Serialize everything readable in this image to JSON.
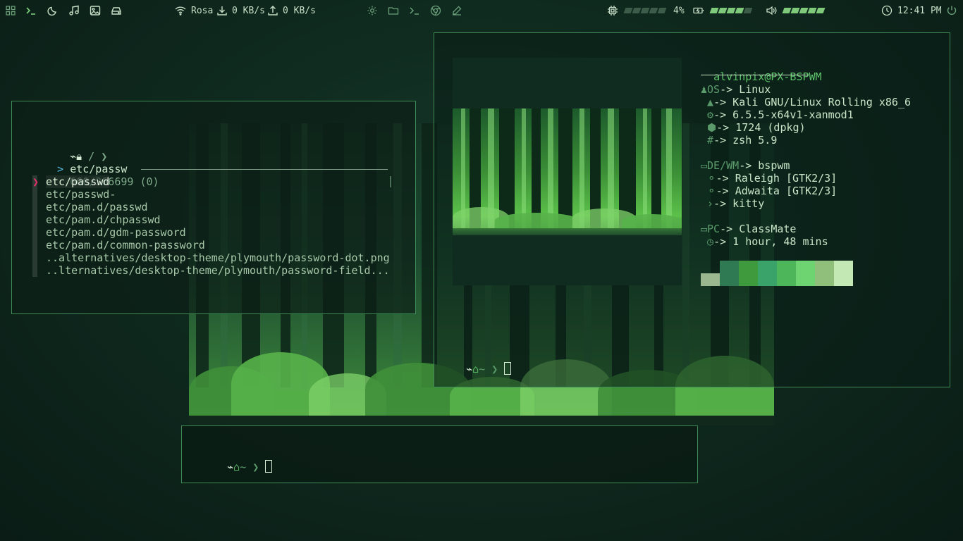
{
  "topbar": {
    "network_name": "Rosa",
    "download_rate": "0 KB/s",
    "upload_rate": "0 KB/s",
    "cpu_percent": "4%",
    "battery_level": 0.8,
    "volume_level": 1.0,
    "time": "12:41 PM",
    "left_icons": [
      "apps-grid-icon",
      "terminal-icon",
      "moon-icon",
      "music-note-icon",
      "image-icon",
      "drive-icon"
    ],
    "center_icons": [
      "settings-icon",
      "folder-icon",
      "terminal-icon",
      "browser-icon",
      "edit-icon"
    ]
  },
  "fzf_window": {
    "prompt_path": "/",
    "query": "etc/passw",
    "match_count": "660/366699 (0)",
    "results": [
      {
        "pre": "etc/",
        "match": "passwd",
        "post": ""
      },
      {
        "pre": "etc/",
        "match": "passwd",
        "post": "-"
      },
      {
        "pre": "etc/pam.d/",
        "match": "passwd",
        "post": ""
      },
      {
        "pre": "etc/pam.d/ch",
        "match": "passwd",
        "post": ""
      },
      {
        "pre": "etc/pam.d/gdm-",
        "match": "password",
        "post": ""
      },
      {
        "pre": "etc/pam.d/common-",
        "match": "password",
        "post": ""
      },
      {
        "pre": "..alternatives/desktop-theme/plymouth/",
        "match": "password",
        "post": "-dot.png"
      },
      {
        "pre": "..lternatives/desktop-theme/plymouth/",
        "match": "password",
        "post": "-field..."
      }
    ]
  },
  "neofetch": {
    "user": "alvinpix",
    "host": "PX-BSPWM",
    "sections": [
      {
        "label": "OS",
        "arrow": "-> ",
        "value": "Linux"
      },
      {
        "label": "",
        "arrow": "-> ",
        "value": "Kali GNU/Linux Rolling x86_6"
      },
      {
        "label": "",
        "arrow": "-> ",
        "value": "6.5.5-x64v1-xanmod1"
      },
      {
        "label": "",
        "arrow": "-> ",
        "value": "1724 (dpkg)"
      },
      {
        "label": "",
        "arrow": "-> ",
        "value": "zsh 5.9"
      },
      {
        "label": "DE/WM",
        "arrow": "-> ",
        "value": "bspwm"
      },
      {
        "label": "",
        "arrow": "-> ",
        "value": "Raleigh [GTK2/3]"
      },
      {
        "label": "",
        "arrow": "-> ",
        "value": "Adwaita [GTK2/3]"
      },
      {
        "label": "",
        "arrow": "-> ",
        "value": "kitty"
      },
      {
        "label": "PC",
        "arrow": "-> ",
        "value": "ClassMate"
      },
      {
        "label": "",
        "arrow": "-> ",
        "value": "1 hour, 48 mins"
      }
    ],
    "palette": [
      "#9ab78f",
      "#2f7a52",
      "#3f9a3e",
      "#3aa36a",
      "#4db55a",
      "#6ed371",
      "#8fbf7a",
      "#c4e8b4"
    ],
    "prompt_path": "~"
  },
  "bottom_terminal": {
    "prompt_path": "~"
  },
  "colors": {
    "accent": "#5ec36b",
    "border": "#3f8a55",
    "pointer": "#e2306c"
  }
}
